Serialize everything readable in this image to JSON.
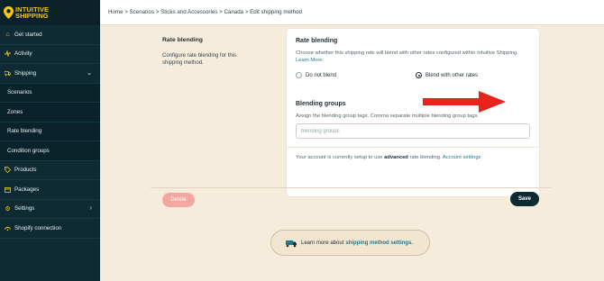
{
  "brand": {
    "line1": "INTUITIVE",
    "line2": "SHIPPING"
  },
  "breadcrumb": "Home > Scenarios > Sticks and Accessories > Canada > Edit shipping method",
  "sidebar": {
    "items": [
      {
        "label": "Get started",
        "icon": "home-icon"
      },
      {
        "label": "Activity",
        "icon": "activity-icon"
      },
      {
        "label": "Shipping",
        "icon": "truck-icon",
        "expanded": true
      },
      {
        "label": "Scenarios",
        "sub": true
      },
      {
        "label": "Zones",
        "sub": true
      },
      {
        "label": "Rate blending",
        "sub": true
      },
      {
        "label": "Condition groups",
        "sub": true
      },
      {
        "label": "Products",
        "icon": "tag-icon"
      },
      {
        "label": "Packages",
        "icon": "box-icon"
      },
      {
        "label": "Settings",
        "icon": "gear-icon"
      },
      {
        "label": "Shopify connection",
        "icon": "link-icon"
      }
    ]
  },
  "section": {
    "title": "Rate blending",
    "description": "Configure rate blending for this shipping method."
  },
  "card": {
    "heading": "Rate blending",
    "description": "Choose whether this shipping rate will blend with other rates configured within Intuitive Shipping.",
    "learn_more": "Learn More.",
    "radio_off": "Do not blend",
    "radio_on": "Blend with other rates",
    "groups_heading": "Blending groups",
    "groups_description": "Assign the blending group tags. Comma separate multiple blending group tags.",
    "groups_placeholder": "blending groups",
    "footnote_prefix": "Your account is currently setup to use",
    "footnote_bold": "advanced",
    "footnote_suffix": "rate blending.",
    "footnote_link": "Account settings"
  },
  "actions": {
    "delete": "Delete",
    "save": "Save"
  },
  "learn_banner": {
    "prefix": "Learn more about",
    "link": "shipping method settings."
  },
  "colors": {
    "sidebar": "#0e2a33",
    "accent": "#f5c518",
    "arrow": "#e8231a",
    "delete": "#f4a6a0",
    "link": "#1f7a8c"
  }
}
